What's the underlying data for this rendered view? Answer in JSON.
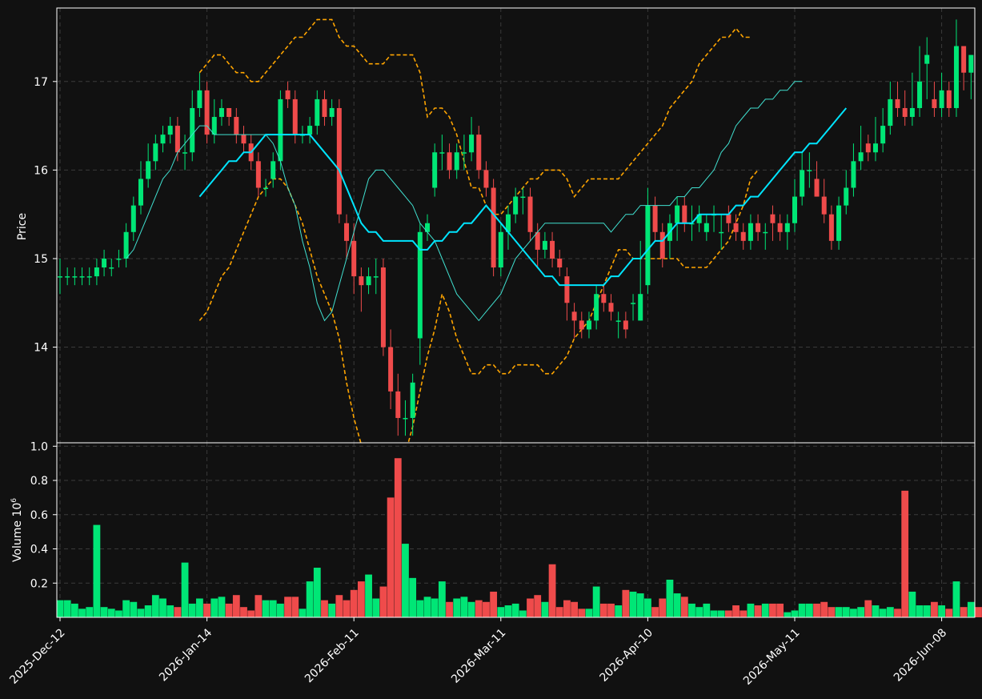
{
  "chart_data": {
    "type": "candlestick",
    "colors": {
      "background": "#111111",
      "up": "#00e676",
      "down": "#ef4b4b",
      "ma_fast": "#40e0d0",
      "ma_slow": "#00e5ff",
      "bands": "#ffa500",
      "grid": "#3a3a3a",
      "frame": "#ffffff"
    },
    "price_panel": {
      "ylabel": "Price",
      "yticks": [
        "14",
        "15",
        "16",
        "17"
      ],
      "ylim": [
        12.92,
        17.83
      ]
    },
    "volume_panel": {
      "ylabel": "Volume  10",
      "ylabel_exponent": "6",
      "yticks": [
        "0.2",
        "0.4",
        "0.6",
        "0.8",
        "1.0"
      ],
      "ylim": [
        0,
        1.02
      ]
    },
    "xtick_labels": [
      "2025-Dec-12",
      "2026-Jan-14",
      "2026-Feb-11",
      "2026-Mar-11",
      "2026-Apr-10",
      "2026-May-11",
      "2026-Jun-08"
    ],
    "xtick_index": [
      0,
      20,
      40,
      60,
      80,
      100,
      120
    ],
    "n_bars": 125,
    "ohlc": {
      "open": [
        14.8,
        14.8,
        14.8,
        14.8,
        14.8,
        14.8,
        14.9,
        14.9,
        15.0,
        15.0,
        15.3,
        15.6,
        15.9,
        16.1,
        16.3,
        16.4,
        16.5,
        16.2,
        16.2,
        16.7,
        16.9,
        16.4,
        16.6,
        16.7,
        16.6,
        16.4,
        16.3,
        16.1,
        15.8,
        15.9,
        16.1,
        16.9,
        16.8,
        16.4,
        16.4,
        16.5,
        16.8,
        16.6,
        16.7,
        15.4,
        15.2,
        14.8,
        14.7,
        14.8,
        14.9,
        14.0,
        13.5,
        13.2,
        13.2,
        14.1,
        15.3,
        15.8,
        16.2,
        16.2,
        16.0,
        16.2,
        16.2,
        16.4,
        16.0,
        15.8,
        14.9,
        15.3,
        15.5,
        15.7,
        15.7,
        15.3,
        15.1,
        15.2,
        15.0,
        14.8,
        14.4,
        14.3,
        14.2,
        14.3,
        14.6,
        14.5,
        14.3,
        14.3,
        14.5,
        14.3,
        14.7,
        15.6,
        15.3,
        15.2,
        15.4,
        15.6,
        15.4,
        15.4,
        15.3,
        15.5,
        15.3,
        15.5,
        15.4,
        15.3,
        15.2,
        15.4,
        15.3,
        15.5,
        15.4,
        15.3,
        15.4,
        15.7,
        16.0,
        15.9,
        15.7,
        15.5,
        15.2,
        15.6,
        15.8,
        16.1,
        16.3,
        16.2,
        16.3,
        16.5,
        16.8,
        16.7,
        16.6,
        16.7,
        17.2,
        16.8,
        16.7,
        16.9,
        16.7,
        17.4,
        17.1,
        17.0
      ],
      "close": [
        14.8,
        14.8,
        14.8,
        14.8,
        14.8,
        14.9,
        15.0,
        14.9,
        15.0,
        15.3,
        15.6,
        15.9,
        16.1,
        16.3,
        16.4,
        16.5,
        16.2,
        16.2,
        16.7,
        16.9,
        16.4,
        16.6,
        16.7,
        16.6,
        16.4,
        16.3,
        16.1,
        15.8,
        15.8,
        16.1,
        16.8,
        16.8,
        16.4,
        16.4,
        16.5,
        16.8,
        16.6,
        16.7,
        15.5,
        15.2,
        14.8,
        14.7,
        14.8,
        14.8,
        14.0,
        13.5,
        13.2,
        13.2,
        13.6,
        15.3,
        15.4,
        16.2,
        16.2,
        16.0,
        16.2,
        16.2,
        16.4,
        16.0,
        15.8,
        14.9,
        15.3,
        15.5,
        15.7,
        15.7,
        15.3,
        15.1,
        15.2,
        15.0,
        14.9,
        14.5,
        14.3,
        14.2,
        14.3,
        14.6,
        14.5,
        14.4,
        14.3,
        14.2,
        14.5,
        14.6,
        15.6,
        15.3,
        15.0,
        15.4,
        15.6,
        15.4,
        15.4,
        15.5,
        15.4,
        15.5,
        15.3,
        15.4,
        15.3,
        15.2,
        15.4,
        15.3,
        15.3,
        15.4,
        15.3,
        15.4,
        15.7,
        16.0,
        16.0,
        15.7,
        15.5,
        15.2,
        15.6,
        15.8,
        16.1,
        16.2,
        16.2,
        16.3,
        16.5,
        16.8,
        16.7,
        16.6,
        16.7,
        17.0,
        17.3,
        16.7,
        16.9,
        16.7,
        17.4,
        17.1,
        17.3
      ],
      "high": [
        15.0,
        14.9,
        14.9,
        14.9,
        14.9,
        15.0,
        15.1,
        15.0,
        15.1,
        15.4,
        15.7,
        16.1,
        16.3,
        16.4,
        16.5,
        16.6,
        16.6,
        16.4,
        16.9,
        17.1,
        17.0,
        16.8,
        16.8,
        16.7,
        16.7,
        16.5,
        16.4,
        16.2,
        15.9,
        16.2,
        16.9,
        17.0,
        16.9,
        16.5,
        16.6,
        16.9,
        16.9,
        16.8,
        16.8,
        15.5,
        15.4,
        14.9,
        14.9,
        15.0,
        15.0,
        14.2,
        13.7,
        13.4,
        13.7,
        15.4,
        15.5,
        16.3,
        16.4,
        16.3,
        16.3,
        16.4,
        16.6,
        16.5,
        16.1,
        15.9,
        15.4,
        15.6,
        15.8,
        15.8,
        15.8,
        15.4,
        15.3,
        15.3,
        15.1,
        14.9,
        14.5,
        14.4,
        14.4,
        14.7,
        14.7,
        14.6,
        14.4,
        14.4,
        14.6,
        15.2,
        15.8,
        15.7,
        15.4,
        15.5,
        15.7,
        15.7,
        15.6,
        15.6,
        15.5,
        15.6,
        15.5,
        15.6,
        15.5,
        15.4,
        15.5,
        15.5,
        15.4,
        15.6,
        15.5,
        15.5,
        15.9,
        16.2,
        16.2,
        16.1,
        15.9,
        15.6,
        15.7,
        16.0,
        16.3,
        16.5,
        16.4,
        16.6,
        16.7,
        17.0,
        17.0,
        16.9,
        17.1,
        17.4,
        17.5,
        17.0,
        17.1,
        17.0,
        17.7,
        17.3,
        17.3
      ],
      "low": [
        14.6,
        14.7,
        14.7,
        14.7,
        14.7,
        14.7,
        14.8,
        14.8,
        14.9,
        14.9,
        15.2,
        15.5,
        15.8,
        16.0,
        16.2,
        16.3,
        16.1,
        16.0,
        16.1,
        16.6,
        16.3,
        16.3,
        16.5,
        16.5,
        16.3,
        16.2,
        16.0,
        15.7,
        15.7,
        15.8,
        16.0,
        16.7,
        16.3,
        16.3,
        16.3,
        16.4,
        16.5,
        16.5,
        15.4,
        15.0,
        14.6,
        14.4,
        14.6,
        14.6,
        13.9,
        13.3,
        13.0,
        13.0,
        13.0,
        13.8,
        15.2,
        15.7,
        16.0,
        15.9,
        15.9,
        16.0,
        16.1,
        15.9,
        15.7,
        14.8,
        14.8,
        15.1,
        15.4,
        15.5,
        15.2,
        14.9,
        15.0,
        14.9,
        14.8,
        14.3,
        14.1,
        14.1,
        14.1,
        14.2,
        14.4,
        14.3,
        14.1,
        14.1,
        14.3,
        14.3,
        14.6,
        15.2,
        14.9,
        15.0,
        15.2,
        15.3,
        15.2,
        15.3,
        15.2,
        15.3,
        15.1,
        15.3,
        15.2,
        15.1,
        15.1,
        15.2,
        15.1,
        15.2,
        15.2,
        15.1,
        15.3,
        15.6,
        15.8,
        15.7,
        15.4,
        15.1,
        15.1,
        15.5,
        15.7,
        16.0,
        16.1,
        16.1,
        16.2,
        16.4,
        16.6,
        16.5,
        16.5,
        16.6,
        16.8,
        16.6,
        16.6,
        16.6,
        16.6,
        16.9,
        16.8
      ]
    },
    "volume": [
      0.1,
      0.1,
      0.08,
      0.05,
      0.06,
      0.54,
      0.06,
      0.05,
      0.04,
      0.1,
      0.09,
      0.05,
      0.07,
      0.13,
      0.11,
      0.07,
      0.06,
      0.32,
      0.08,
      0.11,
      0.08,
      0.11,
      0.12,
      0.08,
      0.13,
      0.06,
      0.04,
      0.13,
      0.1,
      0.1,
      0.08,
      0.12,
      0.12,
      0.05,
      0.21,
      0.29,
      0.1,
      0.08,
      0.13,
      0.1,
      0.16,
      0.21,
      0.25,
      0.11,
      0.18,
      0.7,
      0.93,
      0.43,
      0.23,
      0.1,
      0.12,
      0.11,
      0.21,
      0.09,
      0.11,
      0.12,
      0.09,
      0.1,
      0.09,
      0.15,
      0.06,
      0.07,
      0.08,
      0.04,
      0.11,
      0.13,
      0.09,
      0.31,
      0.06,
      0.1,
      0.09,
      0.05,
      0.05,
      0.18,
      0.08,
      0.08,
      0.07,
      0.16,
      0.15,
      0.14,
      0.11,
      0.06,
      0.11,
      0.22,
      0.14,
      0.12,
      0.08,
      0.06,
      0.08,
      0.04,
      0.04,
      0.04,
      0.07,
      0.04,
      0.08,
      0.07,
      0.08,
      0.08,
      0.08,
      0.03,
      0.04,
      0.08,
      0.08,
      0.08,
      0.09,
      0.06,
      0.06,
      0.06,
      0.05,
      0.06,
      0.1,
      0.07,
      0.05,
      0.06,
      0.05,
      0.74,
      0.15,
      0.07,
      0.07,
      0.09,
      0.07,
      0.05,
      0.21,
      0.06,
      0.09,
      0.06
    ],
    "ma_fast": {
      "start": 9,
      "values": [
        15.0,
        15.1,
        15.3,
        15.5,
        15.7,
        15.9,
        16.0,
        16.2,
        16.3,
        16.4,
        16.5,
        16.5,
        16.4,
        16.4,
        16.4,
        16.4,
        16.4,
        16.4,
        16.4,
        16.4,
        16.3,
        16.1,
        15.8,
        15.6,
        15.2,
        14.9,
        14.5,
        14.3,
        14.4,
        14.7,
        15.0,
        15.3,
        15.6,
        15.9,
        16.0,
        16.0,
        15.9,
        15.8,
        15.7,
        15.6,
        15.4,
        15.3,
        15.2,
        15.0,
        14.8,
        14.6,
        14.5,
        14.4,
        14.3,
        14.4,
        14.5,
        14.6,
        14.8,
        15.0,
        15.1,
        15.2,
        15.3,
        15.4,
        15.4,
        15.4,
        15.4,
        15.4,
        15.4,
        15.4,
        15.4,
        15.4,
        15.3,
        15.4,
        15.5,
        15.5,
        15.6,
        15.6,
        15.6,
        15.6,
        15.6,
        15.7,
        15.7,
        15.8,
        15.8,
        15.9,
        16.0,
        16.2,
        16.3,
        16.5,
        16.6,
        16.7,
        16.7,
        16.8,
        16.8,
        16.9,
        16.9,
        17.0,
        17.0
      ]
    },
    "ma_slow": {
      "start": 19,
      "values": [
        15.7,
        15.8,
        15.9,
        16.0,
        16.1,
        16.1,
        16.2,
        16.2,
        16.3,
        16.4,
        16.4,
        16.4,
        16.4,
        16.4,
        16.4,
        16.4,
        16.3,
        16.2,
        16.1,
        16.0,
        15.8,
        15.6,
        15.4,
        15.3,
        15.3,
        15.2,
        15.2,
        15.2,
        15.2,
        15.2,
        15.1,
        15.1,
        15.2,
        15.2,
        15.3,
        15.3,
        15.4,
        15.4,
        15.5,
        15.6,
        15.5,
        15.4,
        15.3,
        15.2,
        15.1,
        15.0,
        14.9,
        14.8,
        14.8,
        14.7,
        14.7,
        14.7,
        14.7,
        14.7,
        14.7,
        14.7,
        14.8,
        14.8,
        14.9,
        15.0,
        15.0,
        15.1,
        15.2,
        15.2,
        15.3,
        15.4,
        15.4,
        15.4,
        15.5,
        15.5,
        15.5,
        15.5,
        15.5,
        15.6,
        15.6,
        15.7,
        15.7,
        15.8,
        15.9,
        16.0,
        16.1,
        16.2,
        16.2,
        16.3,
        16.3,
        16.4,
        16.5,
        16.6,
        16.7
      ]
    },
    "band_upper": {
      "start": 19,
      "values": [
        17.1,
        17.2,
        17.3,
        17.3,
        17.2,
        17.1,
        17.1,
        17.0,
        17.0,
        17.1,
        17.2,
        17.3,
        17.4,
        17.5,
        17.5,
        17.6,
        17.7,
        17.7,
        17.7,
        17.5,
        17.4,
        17.4,
        17.3,
        17.2,
        17.2,
        17.2,
        17.3,
        17.3,
        17.3,
        17.3,
        17.1,
        16.6,
        16.7,
        16.7,
        16.6,
        16.4,
        16.1,
        15.8,
        15.8,
        15.6,
        15.5,
        15.5,
        15.6,
        15.7,
        15.8,
        15.9,
        15.9,
        16.0,
        16.0,
        16.0,
        15.9,
        15.7,
        15.8,
        15.9,
        15.9,
        15.9,
        15.9,
        15.9,
        16.0,
        16.1,
        16.2,
        16.3,
        16.4,
        16.5,
        16.7,
        16.8,
        16.9,
        17.0,
        17.2,
        17.3,
        17.4,
        17.5,
        17.5,
        17.6,
        17.5,
        17.5
      ]
    },
    "band_lower": {
      "start": 19,
      "values": [
        14.3,
        14.4,
        14.6,
        14.8,
        14.9,
        15.1,
        15.3,
        15.5,
        15.7,
        15.8,
        15.9,
        15.9,
        15.8,
        15.6,
        15.4,
        15.1,
        14.8,
        14.6,
        14.4,
        14.1,
        13.6,
        13.2,
        12.9,
        12.6,
        12.5,
        12.5,
        12.5,
        12.6,
        12.8,
        13.1,
        13.5,
        13.9,
        14.2,
        14.6,
        14.4,
        14.1,
        13.9,
        13.7,
        13.7,
        13.8,
        13.8,
        13.7,
        13.7,
        13.8,
        13.8,
        13.8,
        13.8,
        13.7,
        13.7,
        13.8,
        13.9,
        14.1,
        14.2,
        14.3,
        14.5,
        14.7,
        14.9,
        15.1,
        15.1,
        15.0,
        15.0,
        15.0,
        15.0,
        15.0,
        15.0,
        15.0,
        14.9,
        14.9,
        14.9,
        14.9,
        15.0,
        15.1,
        15.2,
        15.4,
        15.6,
        15.9,
        16.0
      ]
    }
  }
}
